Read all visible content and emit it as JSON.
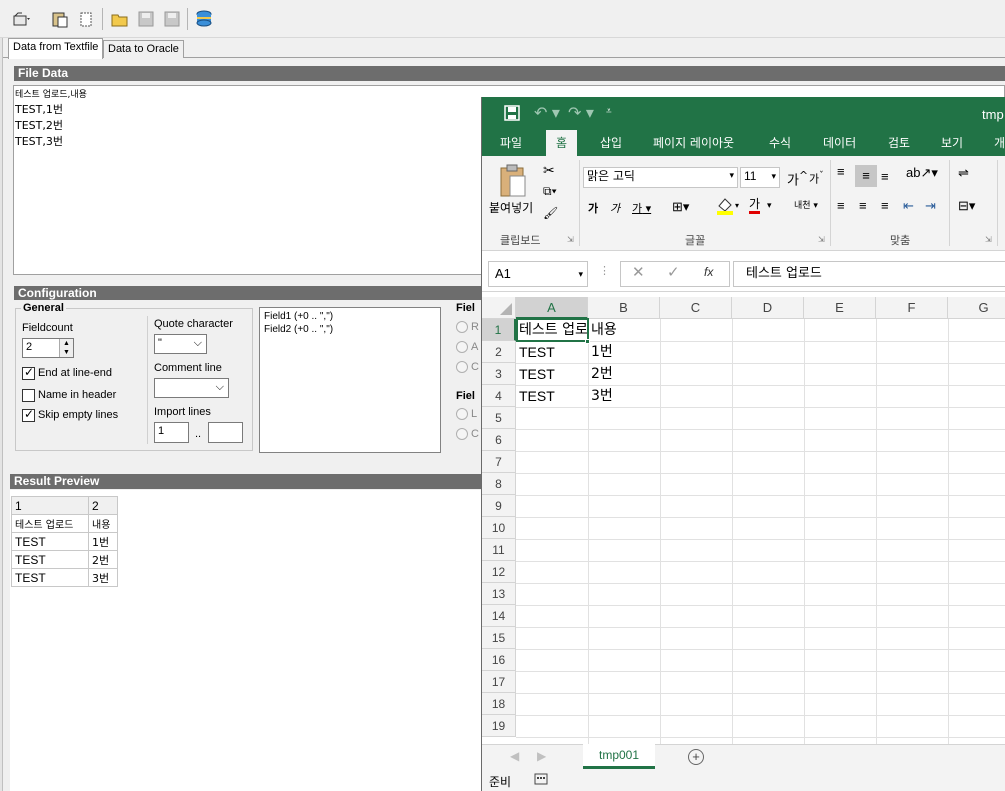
{
  "toolbar": {
    "icons": [
      "open-dropdown-icon",
      "paste-icon",
      "clear-icon",
      "folder-open-icon",
      "save-icon",
      "save-all-icon",
      "database-icon"
    ]
  },
  "tabs": [
    "Data from Textfile",
    "Data to Oracle"
  ],
  "file_data": {
    "title": "File Data",
    "lines": [
      "테스트 업로드,내용",
      "TEST,1번",
      "TEST,2번",
      "TEST,3번"
    ]
  },
  "configuration": {
    "title": "Configuration",
    "general": {
      "title": "General",
      "fieldcount_label": "Fieldcount",
      "fieldcount_value": "2",
      "end_at_line_end": "End at line-end",
      "name_in_header": "Name in header",
      "skip_empty_lines": "Skip empty lines",
      "quote_char_label": "Quote character",
      "quote_char_value": "\"",
      "comment_line_label": "Comment line",
      "comment_line_value": "",
      "import_lines_label": "Import lines",
      "import_from": "1",
      "import_sep": "..",
      "import_to": ""
    },
    "fields": [
      "Field1  (+0 .. \",\")",
      "Field2  (+0 .. \",\")"
    ],
    "field_group1_title": "Fiel",
    "field_group1_options": [
      "R",
      "A",
      "C"
    ],
    "field_group2_title": "Fiel",
    "field_group2_options": [
      "L",
      "C"
    ]
  },
  "result_preview": {
    "title": "Result Preview",
    "header": [
      "1",
      "2"
    ],
    "rows": [
      [
        "테스트 업로드",
        "내용"
      ],
      [
        "TEST",
        "1번"
      ],
      [
        "TEST",
        "2번"
      ],
      [
        "TEST",
        "3번"
      ]
    ]
  },
  "excel": {
    "title_fragment": "tmp",
    "ribbon_tabs": [
      "파일",
      "홈",
      "삽입",
      "페이지 레이아웃",
      "수식",
      "데이터",
      "검토",
      "보기",
      "개"
    ],
    "active_tab": "홈",
    "clipboard": {
      "paste": "붙여넣기",
      "group": "클립보드"
    },
    "font": {
      "name": "맑은 고딕",
      "size": "11",
      "group": "글꼴",
      "bold": "가",
      "italic": "가",
      "underline": "가",
      "grow": "가",
      "shrink": "가",
      "color_letter": "가",
      "phonetic": "내천"
    },
    "align_group": "맞춤",
    "name_box": "A1",
    "formula": "테스트 업로드",
    "fx": "fx",
    "columns": [
      "A",
      "B",
      "C",
      "D",
      "E",
      "F",
      "G"
    ],
    "rows": [
      "1",
      "2",
      "3",
      "4",
      "5",
      "6",
      "7",
      "8",
      "9",
      "10",
      "11",
      "12",
      "13",
      "14",
      "15",
      "16",
      "17",
      "18",
      "19"
    ],
    "cells": [
      [
        "테스트 업로드",
        "내용"
      ],
      [
        "TEST",
        "1번"
      ],
      [
        "TEST",
        "2번"
      ],
      [
        "TEST",
        "3번"
      ]
    ],
    "sheet_tab": "tmp001",
    "status": "준비"
  },
  "colors": {
    "excel_green": "#217346",
    "section_bar": "#6d6d6d"
  }
}
